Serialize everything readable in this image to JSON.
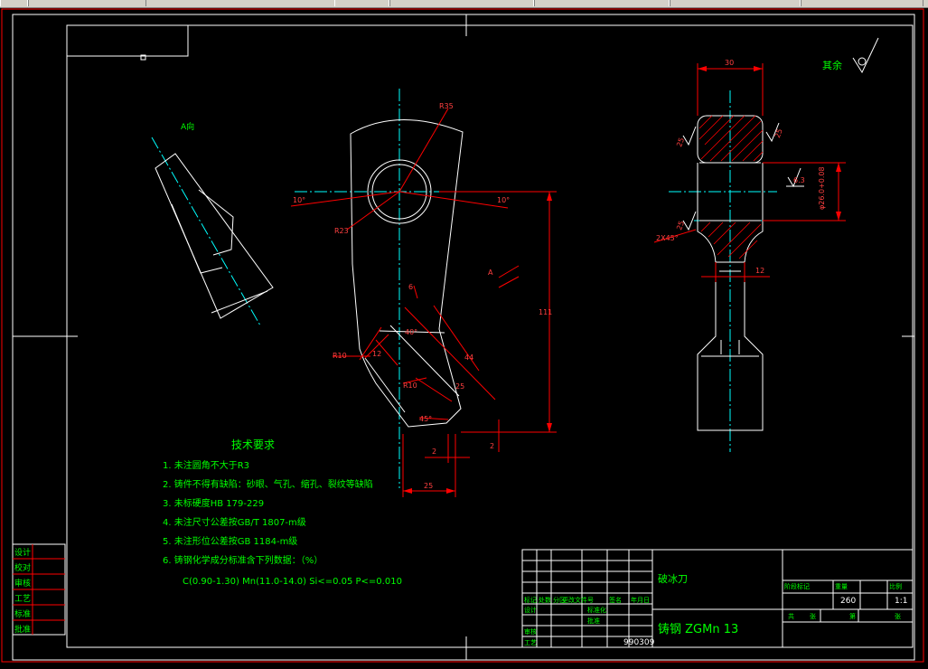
{
  "drawing": {
    "view_label_a": "A向",
    "arrow_label_a": "A",
    "roughness_note": "其余",
    "tech_title": "技术要求",
    "tech_items": [
      "1.  未注圆角不大于R3",
      "2.  铸件不得有缺陷：砂眼、气孔、缩孔、裂纹等缺陷",
      "3.  未标硬度HB 179-229",
      "4.  未注尺寸公差按GB/T 1807-m级",
      "5.  未注形位公差按GB 1184-m级",
      "6.  铸钢化学成分标准含下列数据：（%）"
    ],
    "composition": "C(0.90-1.30)  Mn(11.0-14.0)  Si<=0.05  P<=0.010"
  },
  "dimensions": {
    "r35": "R35",
    "r23": "R23",
    "r10a": "R10",
    "r10b": "R10",
    "ang10l": "10°",
    "ang10r": "10°",
    "ang40": "40°",
    "ang45": "45°",
    "d6": "6",
    "d12": "12",
    "d44": "44",
    "d25s": "25",
    "d111": "111",
    "d2a": "2",
    "d2b": "2",
    "d25": "25",
    "d30": "30",
    "d12s": "12",
    "dia": "φ26.0+0.08",
    "chamfer": "2X45°",
    "ra63": "6.3",
    "ra25a": "25",
    "ra25b": "25",
    "ra25c": "25"
  },
  "title_block": {
    "part_name": "破冰刀",
    "material": "铸钢 ZGMn 13",
    "scale": "1:1",
    "weight": "260",
    "drawing_no": "990309",
    "row_labels": [
      "标记",
      "处数",
      "分区",
      "更改文件号",
      "签名",
      "年月日"
    ],
    "sign_labels": [
      "设计",
      "审核",
      "工艺"
    ],
    "std_labels": [
      "标准化",
      "批准"
    ],
    "stage_labels": [
      "阶段标记",
      "重量",
      "比例"
    ],
    "sheet_labels": [
      "共",
      "张",
      "第",
      "张"
    ]
  },
  "side_stamp": [
    "设计",
    "校对",
    "审核",
    "工艺",
    "标准",
    "批准"
  ]
}
